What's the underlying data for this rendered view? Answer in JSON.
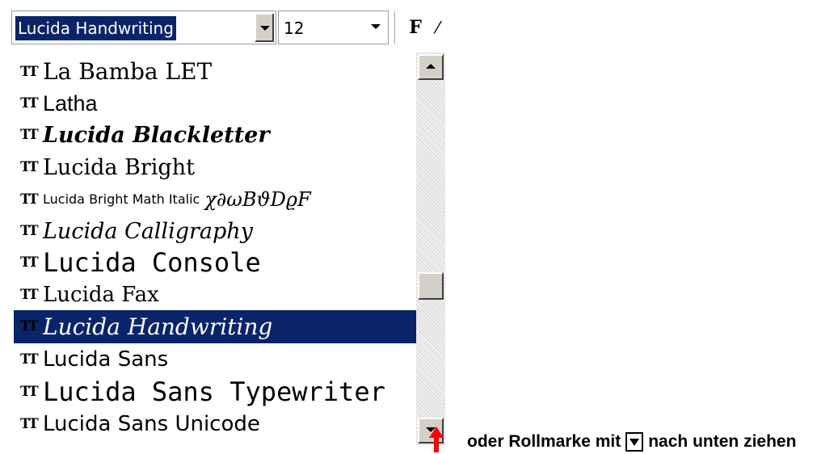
{
  "toolbar": {
    "font_value": "Lucida Handwriting",
    "size_value": "12",
    "bold_label": "F",
    "cut_label": "⁄"
  },
  "font_list": {
    "selected_index": 8,
    "items": [
      {
        "icon": "truetype-icon",
        "label": "La Bamba LET"
      },
      {
        "icon": "truetype-icon",
        "label": "Latha"
      },
      {
        "icon": "truetype-icon",
        "label": "Lucida Blackletter"
      },
      {
        "icon": "truetype-icon",
        "label": "Lucida Bright"
      },
      {
        "icon": "truetype-icon",
        "label": "Lucida Bright Math Italic",
        "sample": "χ∂ωΒϑDϱF"
      },
      {
        "icon": "truetype-icon",
        "label": "Lucida Calligraphy"
      },
      {
        "icon": "truetype-icon",
        "label": "Lucida Console"
      },
      {
        "icon": "truetype-icon",
        "label": "Lucida Fax"
      },
      {
        "icon": "truetype-icon",
        "label": "Lucida Handwriting"
      },
      {
        "icon": "truetype-icon",
        "label": "Lucida Sans"
      },
      {
        "icon": "truetype-icon",
        "label": "Lucida Sans Typewriter"
      },
      {
        "icon": "truetype-icon",
        "label": "Lucida Sans Unicode"
      }
    ],
    "truetype_glyph": "TT"
  },
  "scrollbar": {
    "position_fraction": 0.62
  },
  "annotation": {
    "text_before": "oder Rollmarke  mit",
    "text_after": "nach unten ziehen",
    "box_icon": "down-arrow-box-icon",
    "pointer_color": "#ff0000"
  },
  "colors": {
    "selection": "#0a246a",
    "button_face": "#d4d0c8"
  }
}
